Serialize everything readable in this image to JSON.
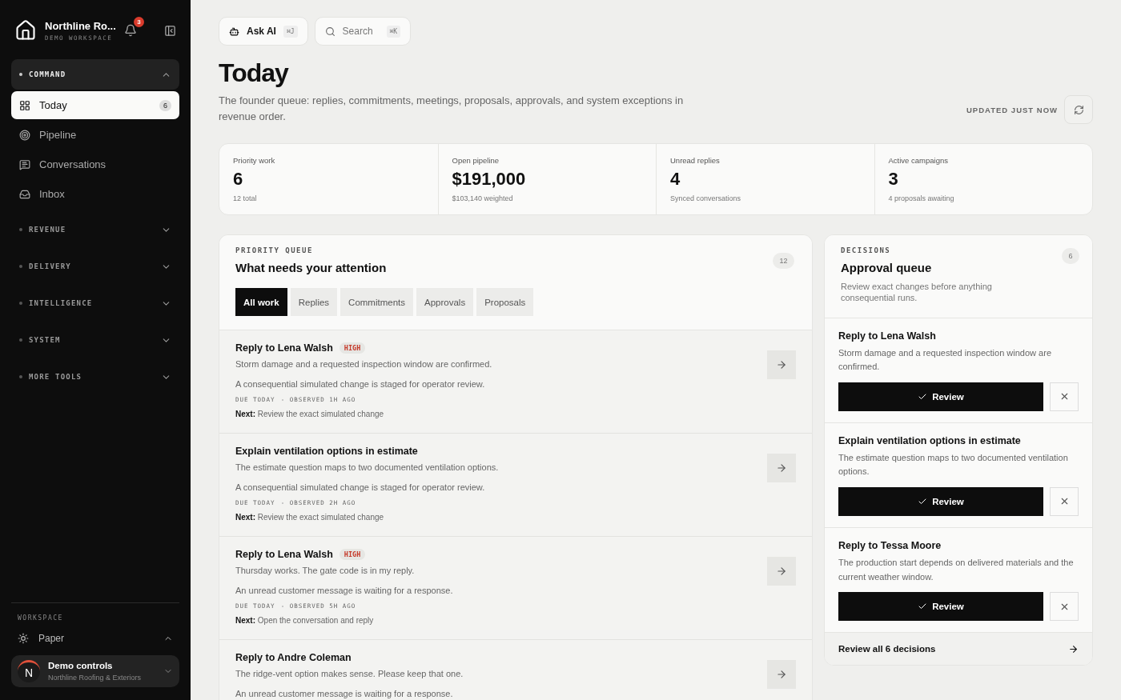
{
  "sidebar": {
    "brand": {
      "name": "Northline Ro...",
      "subtitle": "DEMO WORKSPACE"
    },
    "notifications": "3",
    "sections": [
      {
        "label": "COMMAND",
        "expanded": true,
        "items": [
          {
            "label": "Today",
            "badge": "6",
            "selected": true
          },
          {
            "label": "Pipeline",
            "selected": false
          },
          {
            "label": "Conversations",
            "selected": false
          },
          {
            "label": "Inbox",
            "selected": false
          }
        ]
      },
      {
        "label": "REVENUE",
        "expanded": false
      },
      {
        "label": "DELIVERY",
        "expanded": false
      },
      {
        "label": "INTELLIGENCE",
        "expanded": false
      },
      {
        "label": "SYSTEM",
        "expanded": false
      },
      {
        "label": "MORE TOOLS",
        "expanded": false
      }
    ],
    "workspace": {
      "label": "WORKSPACE",
      "theme": "Paper",
      "expanded": true
    },
    "account": {
      "initial": "N",
      "name": "Demo controls",
      "org": "Northline Roofing & Exteriors"
    }
  },
  "toolbar": {
    "ask_ai": {
      "label": "Ask AI",
      "shortcut": "⌘J"
    },
    "search": {
      "placeholder": "Search",
      "shortcut": "⌘K"
    }
  },
  "header": {
    "title": "Today",
    "description": "The founder queue: replies, commitments, meetings, proposals, approvals, and system exceptions in revenue order.",
    "updated": "UPDATED JUST NOW"
  },
  "stats": [
    {
      "label": "Priority work",
      "value": "6",
      "note": "12 total"
    },
    {
      "label": "Open pipeline",
      "value": "$191,000",
      "note": "$103,140 weighted"
    },
    {
      "label": "Unread replies",
      "value": "4",
      "note": "Synced conversations"
    },
    {
      "label": "Active campaigns",
      "value": "3",
      "note": "4 proposals awaiting"
    }
  ],
  "queue": {
    "eyebrow": "PRIORITY QUEUE",
    "title": "What needs your attention",
    "count": "12",
    "tabs": [
      {
        "label": "All work",
        "selected": true
      },
      {
        "label": "Replies",
        "selected": false
      },
      {
        "label": "Commitments",
        "selected": false
      },
      {
        "label": "Approvals",
        "selected": false
      },
      {
        "label": "Proposals",
        "selected": false
      }
    ],
    "items": [
      {
        "title": "Reply to Lena Walsh",
        "priority": "HIGH",
        "summary": "Storm damage and a requested inspection window are confirmed.",
        "detail": "A consequential simulated change is staged for operator review.",
        "meta": [
          "DUE TODAY",
          "OBSERVED 1H AGO"
        ],
        "next": "**Next:** Review the exact simulated change"
      },
      {
        "title": "Explain ventilation options in estimate",
        "summary": "The estimate question maps to two documented ventilation options.",
        "detail": "A consequential simulated change is staged for operator review.",
        "meta": [
          "DUE TODAY",
          "OBSERVED 2H AGO"
        ],
        "next": "**Next:** Review the exact simulated change"
      },
      {
        "title": "Reply to Lena Walsh",
        "priority": "HIGH",
        "summary": "Thursday works. The gate code is in my reply.",
        "detail": "An unread customer message is waiting for a response.",
        "meta": [
          "DUE TODAY",
          "OBSERVED 5H AGO"
        ],
        "next": "**Next:** Open the conversation and reply"
      },
      {
        "title": "Reply to Andre Coleman",
        "summary": "The ridge-vent option makes sense. Please keep that one.",
        "detail": "An unread customer message is waiting for a response."
      }
    ]
  },
  "decisions": {
    "eyebrow": "DECISIONS",
    "title": "Approval queue",
    "count": "6",
    "description": "Review exact changes before anything consequential runs.",
    "items": [
      {
        "title": "Reply to Lena Walsh",
        "summary": "Storm damage and a requested inspection window are confirmed.",
        "action": "Review"
      },
      {
        "title": "Explain ventilation options in estimate",
        "summary": "The estimate question maps to two documented ventilation options.",
        "action": "Review"
      },
      {
        "title": "Reply to Tessa Moore",
        "summary": "The production start depends on delivered materials and the current weather window.",
        "action": "Review"
      }
    ],
    "footer": "Review all 6 decisions"
  }
}
